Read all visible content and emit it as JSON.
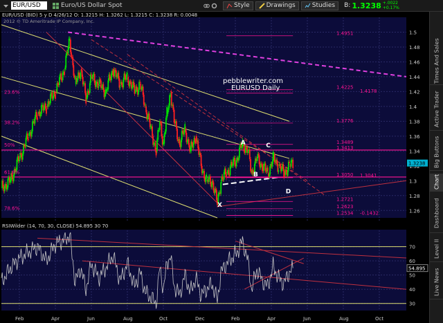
{
  "toolbar": {
    "symbol": "EUR/USD",
    "description": "Euro/US Dollar Spot",
    "style_label": "Style",
    "drawings_label": "Drawings",
    "studies_label": "Studies",
    "quote_prefix": "B:",
    "quote": "1.3238",
    "change_top": "+.0022",
    "change_bottom": "+0.17%"
  },
  "sidebar": {
    "tabs": [
      "Times And Sales",
      "Active Trader",
      "Big Buttons",
      "Chart",
      "Dashboard",
      "Level II",
      "Live News"
    ]
  },
  "colors": {
    "background": "#000000",
    "plot_bg": "#0c0c3a",
    "grid": "#2a2a66",
    "bull": "#00e000",
    "bear": "#ff2020",
    "fib": "#ff1493",
    "trend_red": "#c0303f",
    "yellow_line": "#dede70",
    "magenta_dash": "#e040e0",
    "rsi_line": "#c8c8c8",
    "price_label_bg": "#00b0d0"
  },
  "chart_data": [
    {
      "type": "candlestick",
      "header": "EUR/USD (BID) 5 y D  4/26/12  O: 1.3215  H: 1.3262  L: 1.3215  C: 1.3238  R: 0.0048",
      "copyright": "2012 © TD Ameritrade IP Company, Inc.",
      "watermark_site": "pebblewriter.com",
      "watermark_title": "EURUSD Daily",
      "last_price": "1.3238",
      "ylim": [
        1.25,
        1.52
      ],
      "y_ticks": [
        "1.5",
        "1.48",
        "1.46",
        "1.44",
        "1.42",
        "1.4",
        "1.38",
        "1.36",
        "1.34",
        "1.32",
        "1.3",
        "1.28",
        "1.26"
      ],
      "y_tick_values": [
        1.5,
        1.48,
        1.46,
        1.44,
        1.42,
        1.4,
        1.38,
        1.36,
        1.34,
        1.32,
        1.3,
        1.28,
        1.26
      ],
      "x_ticks": [
        "Feb",
        "Apr",
        "Jun",
        "Aug",
        "Oct",
        "Dec",
        "Feb",
        "Apr",
        "Jun",
        "Aug",
        "Oct"
      ],
      "x_tick_months": [
        1,
        3,
        5,
        7,
        9,
        11,
        13,
        15,
        17,
        19,
        21
      ],
      "x_range_months": [
        0,
        22.5
      ],
      "close_path": [
        [
          0.0,
          1.29
        ],
        [
          0.5,
          1.3
        ],
        [
          1.0,
          1.33
        ],
        [
          1.5,
          1.36
        ],
        [
          2.0,
          1.39
        ],
        [
          2.5,
          1.4
        ],
        [
          3.0,
          1.42
        ],
        [
          3.5,
          1.45
        ],
        [
          3.8,
          1.49
        ],
        [
          4.1,
          1.43
        ],
        [
          4.4,
          1.45
        ],
        [
          4.7,
          1.41
        ],
        [
          5.0,
          1.44
        ],
        [
          5.4,
          1.43
        ],
        [
          5.8,
          1.42
        ],
        [
          6.2,
          1.45
        ],
        [
          6.6,
          1.43
        ],
        [
          7.0,
          1.44
        ],
        [
          7.4,
          1.42
        ],
        [
          7.7,
          1.43
        ],
        [
          8.0,
          1.4
        ],
        [
          8.3,
          1.37
        ],
        [
          8.6,
          1.34
        ],
        [
          8.8,
          1.38
        ],
        [
          9.0,
          1.35
        ],
        [
          9.2,
          1.39
        ],
        [
          9.4,
          1.42
        ],
        [
          9.6,
          1.38
        ],
        [
          9.9,
          1.35
        ],
        [
          10.2,
          1.37
        ],
        [
          10.5,
          1.34
        ],
        [
          10.8,
          1.36
        ],
        [
          11.1,
          1.32
        ],
        [
          11.4,
          1.3
        ],
        [
          11.7,
          1.3
        ],
        [
          12.0,
          1.27
        ],
        [
          12.2,
          1.3
        ],
        [
          12.5,
          1.31
        ],
        [
          12.8,
          1.32
        ],
        [
          13.1,
          1.33
        ],
        [
          13.4,
          1.35
        ],
        [
          13.7,
          1.34
        ],
        [
          13.9,
          1.31
        ],
        [
          14.2,
          1.33
        ],
        [
          14.5,
          1.32
        ],
        [
          14.8,
          1.31
        ],
        [
          15.1,
          1.33
        ],
        [
          15.4,
          1.32
        ],
        [
          15.7,
          1.31
        ],
        [
          16.0,
          1.32
        ],
        [
          16.2,
          1.3238
        ]
      ],
      "price_labels": [
        {
          "text": "1.4951",
          "value": 1.4951
        },
        {
          "text": "1.4225",
          "value": 1.4225
        },
        {
          "text": "1.4178",
          "value": 1.4178
        },
        {
          "text": "1.3776",
          "value": 1.3776
        },
        {
          "text": "1.3489",
          "value": 1.3489
        },
        {
          "text": "1.3413",
          "value": 1.3413
        },
        {
          "text": "1.3050",
          "value": 1.305
        },
        {
          "text": "1.3041",
          "value": 1.3041
        },
        {
          "text": "1.2721",
          "value": 1.2721
        },
        {
          "text": "1.2623",
          "value": 1.2623
        },
        {
          "text": "1.2534",
          "value": 1.2534
        },
        {
          "text": "-0.1432",
          "value": 1.2534
        }
      ],
      "fib_labels": [
        {
          "text": "23.6%",
          "value": 1.416
        },
        {
          "text": "38.2%",
          "value": 1.375
        },
        {
          "text": "50%",
          "value": 1.345
        },
        {
          "text": "61.8%",
          "value": 1.308
        },
        {
          "text": "78.6%",
          "value": 1.26
        }
      ],
      "pattern_points": [
        {
          "label": "A",
          "month": 13.3,
          "value": 1.3489
        },
        {
          "label": "B",
          "month": 14.0,
          "value": 1.306
        },
        {
          "label": "C",
          "month": 14.7,
          "value": 1.345
        },
        {
          "label": "D",
          "month": 15.8,
          "value": 1.283
        },
        {
          "label": "X",
          "month": 12.0,
          "value": 1.265
        }
      ]
    },
    {
      "type": "line",
      "header": "RSIWilder (14, 70, 30, CLOSE)",
      "value_text": "54.895",
      "level_high": "30",
      "level_low": "70",
      "ylim": [
        25,
        82
      ],
      "y_ticks": [
        "70",
        "60",
        "50",
        "40",
        "30"
      ],
      "y_tick_values": [
        70,
        60,
        50,
        40,
        30
      ],
      "last_value": 54.895,
      "values": [
        [
          0.0,
          45
        ],
        [
          0.5,
          55
        ],
        [
          1.0,
          62
        ],
        [
          1.5,
          66
        ],
        [
          2.0,
          70
        ],
        [
          2.5,
          60
        ],
        [
          3.0,
          72
        ],
        [
          3.5,
          75
        ],
        [
          3.8,
          78
        ],
        [
          4.1,
          45
        ],
        [
          4.4,
          55
        ],
        [
          4.7,
          40
        ],
        [
          5.0,
          58
        ],
        [
          5.4,
          48
        ],
        [
          5.8,
          55
        ],
        [
          6.2,
          64
        ],
        [
          6.6,
          46
        ],
        [
          7.0,
          58
        ],
        [
          7.4,
          42
        ],
        [
          7.7,
          52
        ],
        [
          8.0,
          38
        ],
        [
          8.3,
          34
        ],
        [
          8.6,
          30
        ],
        [
          8.8,
          55
        ],
        [
          9.0,
          40
        ],
        [
          9.2,
          58
        ],
        [
          9.4,
          64
        ],
        [
          9.6,
          42
        ],
        [
          9.9,
          36
        ],
        [
          10.2,
          50
        ],
        [
          10.5,
          38
        ],
        [
          10.8,
          48
        ],
        [
          11.1,
          36
        ],
        [
          11.4,
          40
        ],
        [
          11.7,
          44
        ],
        [
          12.0,
          32
        ],
        [
          12.2,
          52
        ],
        [
          12.5,
          58
        ],
        [
          12.8,
          62
        ],
        [
          13.1,
          66
        ],
        [
          13.4,
          74
        ],
        [
          13.7,
          60
        ],
        [
          13.9,
          40
        ],
        [
          14.2,
          54
        ],
        [
          14.5,
          46
        ],
        [
          14.8,
          42
        ],
        [
          15.1,
          56
        ],
        [
          15.4,
          48
        ],
        [
          15.7,
          44
        ],
        [
          16.0,
          52
        ],
        [
          16.2,
          54.895
        ]
      ]
    }
  ]
}
